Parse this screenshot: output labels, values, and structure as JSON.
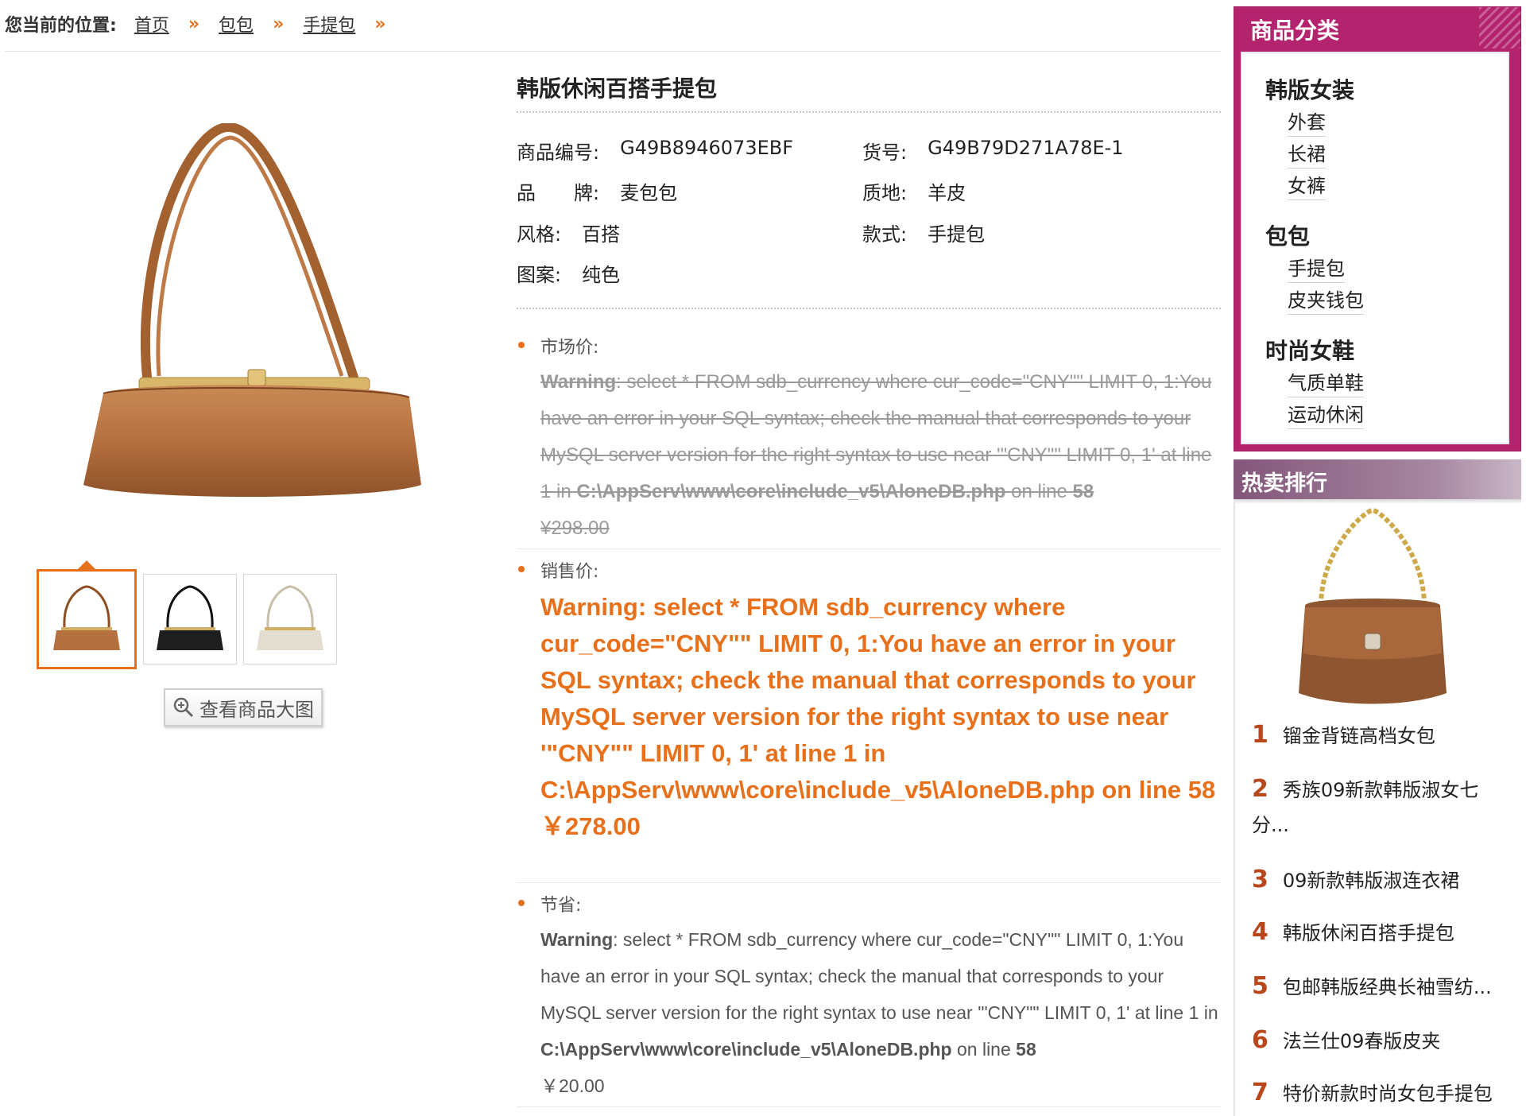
{
  "breadcrumb": {
    "label": "您当前的位置:",
    "items": [
      "首页",
      "包包",
      "手提包"
    ],
    "separator": "»"
  },
  "product": {
    "title": "韩版休闲百搭手提包",
    "attrs": {
      "code_label": "商品编号:",
      "code_value": "G49B8946073EBF",
      "sku_label": "货号:",
      "sku_value": "G49B79D271A78E-1",
      "brand_label": "品　　牌:",
      "brand_value": "麦包包",
      "material_label": "质地:",
      "material_value": "羊皮",
      "style_label": "风格:",
      "style_value": "百搭",
      "type_label": "款式:",
      "type_value": "手提包",
      "pattern_label": "图案:",
      "pattern_value": "纯色"
    },
    "zoom_label": "查看商品大图",
    "thumbnails": [
      "brown",
      "black",
      "beige"
    ],
    "colors": {
      "brown": "#b5703f",
      "black": "#1e1e1e",
      "beige": "#e3ddcf",
      "accent": "#e8701a"
    }
  },
  "prices": {
    "market": {
      "label": "市场价:",
      "warning_strong": "Warning",
      "warning_text": ": select * FROM sdb_currency where cur_code=\"CNY\"\" LIMIT 0, 1:You have an error in your SQL syntax; check the manual that corresponds to your MySQL server version for the right syntax to use near '\"CNY\"\" LIMIT 0, 1' at line 1 in ",
      "warning_path": "C:\\AppServ\\www\\core\\include_v5\\AloneDB.php",
      "warning_online": " on line ",
      "warning_line": "58",
      "value": "¥298.00"
    },
    "sale": {
      "label": "销售价:",
      "warning": "Warning: select * FROM sdb_currency where cur_code=\"CNY\"\" LIMIT 0, 1:You have an error in your SQL syntax; check the manual that corresponds to your MySQL server version for the right syntax to use near '\"CNY\"\" LIMIT 0, 1' at line 1 in C:\\AppServ\\www\\core\\include_v5\\AloneDB.php on line 58",
      "value": "￥278.00"
    },
    "save": {
      "label": "节省:",
      "warning_strong": "Warning",
      "warning_text": ": select * FROM sdb_currency where cur_code=\"CNY\"\" LIMIT 0, 1:You have an error in your SQL syntax; check the manual that corresponds to your MySQL server version for the right syntax to use near '\"CNY\"\" LIMIT 0, 1' at line 1 in ",
      "warning_path": "C:\\AppServ\\www\\core\\include_v5\\AloneDB.php",
      "warning_online": " on line ",
      "warning_line": "58",
      "value": "￥20.00"
    }
  },
  "sidebar": {
    "category_title": "商品分类",
    "groups": [
      {
        "name": "韩版女装",
        "items": [
          "外套",
          "长裙",
          "女裤"
        ]
      },
      {
        "name": "包包",
        "items": [
          "手提包",
          "皮夹钱包"
        ]
      },
      {
        "name": "时尚女鞋",
        "items": [
          "气质单鞋",
          "运动休闲"
        ]
      }
    ],
    "hot_title": "热卖排行",
    "ranking": [
      {
        "n": "1",
        "name": "镏金背链高档女包"
      },
      {
        "n": "2",
        "name": "秀族09新款韩版淑女七分..."
      },
      {
        "n": "3",
        "name": "09新款韩版淑连衣裙"
      },
      {
        "n": "4",
        "name": "韩版休闲百搭手提包"
      },
      {
        "n": "5",
        "name": "包邮韩版经典长袖雪纺..."
      },
      {
        "n": "6",
        "name": "法兰仕09春版皮夹"
      },
      {
        "n": "7",
        "name": "特价新款时尚女包手提包"
      }
    ]
  }
}
